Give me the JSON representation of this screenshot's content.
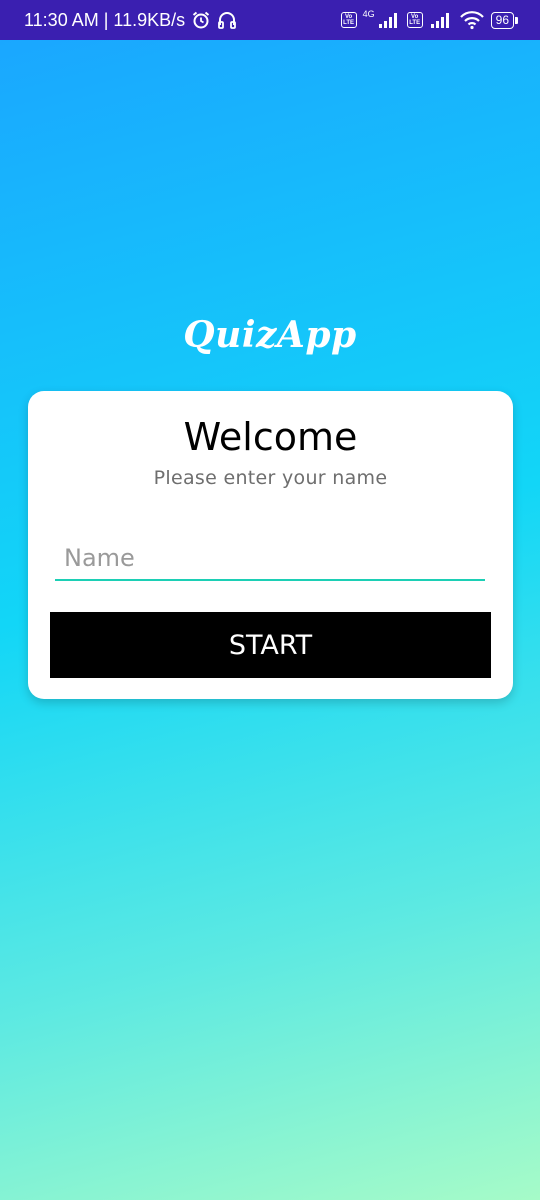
{
  "status_bar": {
    "time_and_speed": "11:30 AM | 11.9KB/s",
    "icons": [
      "alarm-icon",
      "headphones-icon",
      "volte-icon",
      "signal-icon",
      "volte-icon",
      "signal-icon",
      "wifi-icon",
      "battery-icon"
    ],
    "network_type": "4G",
    "volte_top": "Vo",
    "volte_bottom": "LTE",
    "battery_level": "96"
  },
  "app": {
    "title": "QuizApp"
  },
  "card": {
    "title": "Welcome",
    "subtitle": "Please enter your name",
    "name_input": {
      "placeholder": "Name",
      "value": ""
    },
    "start_label": "START"
  },
  "colors": {
    "status_bar": "#3a1fb0",
    "gradient_top": "#1aa7ff",
    "gradient_mid": "#12d6f7",
    "gradient_bottom": "#a6fbc8",
    "input_underline": "#1ccfb5",
    "button": "#000000"
  }
}
